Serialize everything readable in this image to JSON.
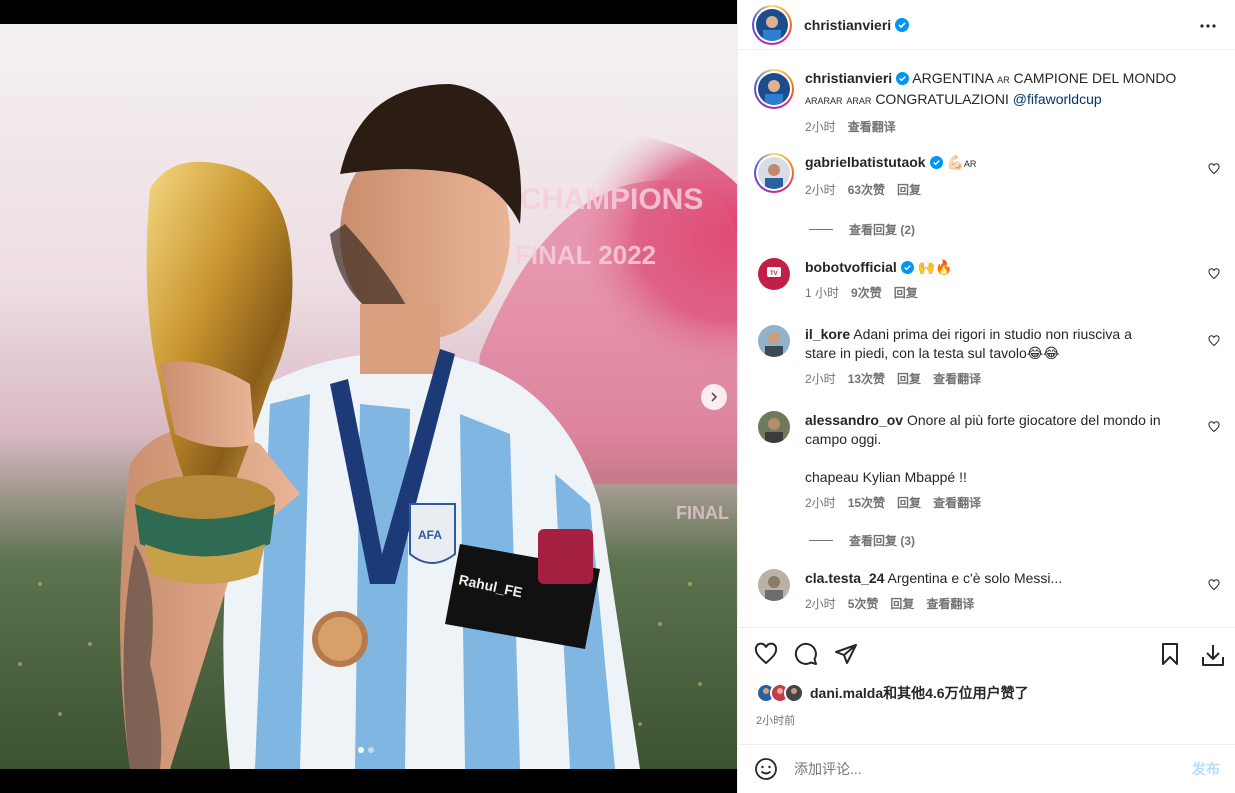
{
  "post": {
    "author": "christianvieri",
    "caption_text": "ARGENTINA",
    "caption_flag1": "AR",
    "caption_text2": "CAMPIONE DEL MONDO",
    "caption_flags2": "ARARAR",
    "caption_flags3": "ARAR",
    "caption_text3": "CONGRATULAZIONI",
    "caption_mention": "@fifaworldcup",
    "caption_time": "2小时",
    "caption_translate": "查看翻译"
  },
  "image": {
    "trophy_banner_line1": "CHAMPIONS",
    "trophy_banner_line2": "FINAL 2022",
    "armband_text": "Rahul_FE",
    "badge_text": "AFA",
    "right_banner": "FINAL"
  },
  "comments": [
    {
      "user": "gabrielbatistutaok",
      "verified": true,
      "text": "💪🏻",
      "flag": "AR",
      "time": "2小时",
      "likes": "63次赞",
      "reply": "回复",
      "translate": ""
    },
    {
      "user": "bobotvofficial",
      "verified": true,
      "text": "🙌🔥",
      "flag": "",
      "time": "1 小时",
      "likes": "9次赞",
      "reply": "回复",
      "translate": ""
    },
    {
      "user": "il_kore",
      "verified": false,
      "text": "Adani prima dei rigori in studio non riusciva a stare in piedi, con la testa sul tavolo😂😂",
      "flag": "",
      "time": "2小时",
      "likes": "13次赞",
      "reply": "回复",
      "translate": "查看翻译"
    },
    {
      "user": "alessandro_ov",
      "verified": false,
      "text": "Onore al più forte giocatore del mondo in campo oggi.",
      "text2": "chapeau Kylian Mbappé !!",
      "flag": "",
      "time": "2小时",
      "likes": "15次赞",
      "reply": "回复",
      "translate": "查看翻译"
    },
    {
      "user": "cla.testa_24",
      "verified": false,
      "text": "Argentina e c'è solo Messi...",
      "flag": "",
      "time": "2小时",
      "likes": "5次赞",
      "reply": "回复",
      "translate": "查看翻译"
    }
  ],
  "view_replies": [
    "查看回复 (2)",
    "查看回复 (3)"
  ],
  "likes": {
    "text": "dani.malda和其他4.6万位用户赞了"
  },
  "posted_time": "2小时前",
  "add_comment": {
    "placeholder": "添加评论...",
    "post": "发布"
  },
  "colors": {
    "accent": "#0095f6",
    "verified": "#0095f6",
    "muted": "#737373"
  }
}
